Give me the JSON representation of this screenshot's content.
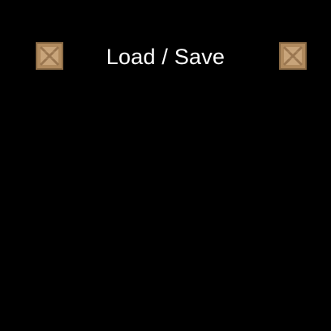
{
  "screen": {
    "title": "Load / Save"
  },
  "decorations": {
    "left_icon": "wooden-crate-icon",
    "right_icon": "wooden-crate-icon"
  },
  "colors": {
    "background": "#000000",
    "title_text": "#ffffff",
    "crate_wood": "#c8a47a",
    "crate_edge": "#8a6a45"
  }
}
